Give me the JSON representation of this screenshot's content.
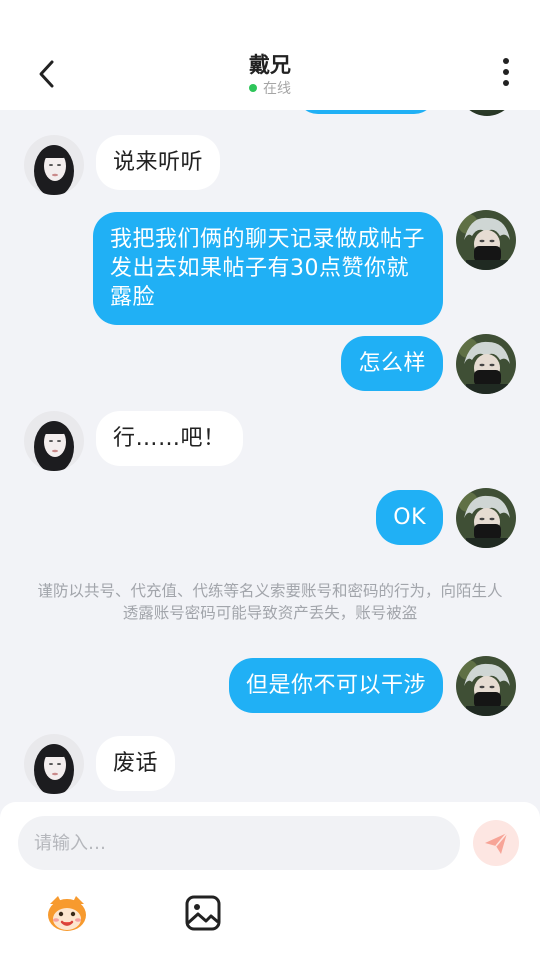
{
  "header": {
    "title": "戴兄",
    "status": "在线",
    "status_color": "#2ec55a"
  },
  "messages": [
    {
      "side": "in",
      "text": "说来听听"
    },
    {
      "side": "out",
      "text": "我把我们俩的聊天记录做成帖子发出去如果帖子有30点赞你就露脸"
    },
    {
      "side": "out",
      "text": "怎么样"
    },
    {
      "side": "in",
      "text": "行……吧！"
    },
    {
      "side": "out",
      "text": "OK"
    },
    {
      "side": "out",
      "text": "但是你不可以干涉"
    },
    {
      "side": "in",
      "text": "废话"
    }
  ],
  "notice": "谨防以共号、代充值、代练等名义索要账号和密码的行为，向陌生人透露账号密码可能导致资产丢失，账号被盗",
  "input": {
    "placeholder": "请输入…",
    "value": ""
  },
  "toolbar": {
    "emoji_icon": "emoji-face-icon",
    "image_icon": "image-icon",
    "send_icon": "send-icon"
  },
  "colors": {
    "outgoing_bubble": "#20b0f5",
    "incoming_bubble": "#ffffff",
    "background": "#f2f3f7",
    "send_button_bg": "#fde6e2",
    "send_button_icon": "#f7a497"
  }
}
